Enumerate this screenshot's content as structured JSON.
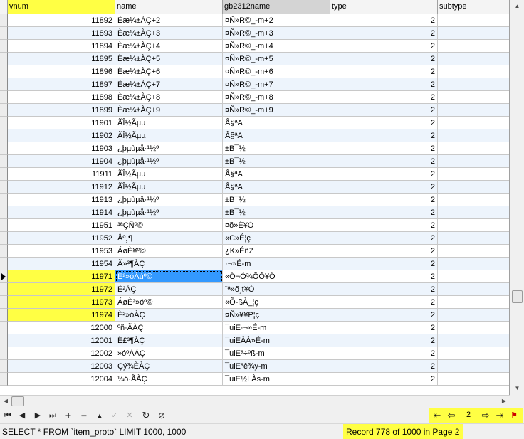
{
  "columns": [
    "vnum",
    "name",
    "gb2312name",
    "type",
    "subtype"
  ],
  "rows": [
    {
      "vnum": "11892",
      "name": "Èæ¼±ÀÇ+2",
      "gb": "¤Ñ»R©_-m+2",
      "type": "2",
      "subtype": ""
    },
    {
      "vnum": "11893",
      "name": "Èæ¼±ÀÇ+3",
      "gb": "¤Ñ»R©_-m+3",
      "type": "2",
      "subtype": ""
    },
    {
      "vnum": "11894",
      "name": "Èæ¼±ÀÇ+4",
      "gb": "¤Ñ»R©_-m+4",
      "type": "2",
      "subtype": ""
    },
    {
      "vnum": "11895",
      "name": "Èæ¼±ÀÇ+5",
      "gb": "¤Ñ»R©_-m+5",
      "type": "2",
      "subtype": ""
    },
    {
      "vnum": "11896",
      "name": "Èæ¼±ÀÇ+6",
      "gb": "¤Ñ»R©_-m+6",
      "type": "2",
      "subtype": ""
    },
    {
      "vnum": "11897",
      "name": "Èæ¼±ÀÇ+7",
      "gb": "¤Ñ»R©_-m+7",
      "type": "2",
      "subtype": ""
    },
    {
      "vnum": "11898",
      "name": "Èæ¼±ÀÇ+8",
      "gb": "¤Ñ»R©_-m+8",
      "type": "2",
      "subtype": ""
    },
    {
      "vnum": "11899",
      "name": "Èæ¼±ÀÇ+9",
      "gb": "¤Ñ»R©_-m+9",
      "type": "2",
      "subtype": ""
    },
    {
      "vnum": "11901",
      "name": "ÃÎ½Ãµµ",
      "gb": "Â§ªA",
      "type": "2",
      "subtype": ""
    },
    {
      "vnum": "11902",
      "name": "ÃÎ½Ãµµ",
      "gb": "Â§ªA",
      "type": "2",
      "subtype": ""
    },
    {
      "vnum": "11903",
      "name": "¿þµùµå·¹½º",
      "gb": "±B¯½",
      "type": "2",
      "subtype": ""
    },
    {
      "vnum": "11904",
      "name": "¿þµùµå·¹½º",
      "gb": "±B¯½",
      "type": "2",
      "subtype": ""
    },
    {
      "vnum": "11911",
      "name": "ÃÎ½Ãµµ",
      "gb": "Â§ªA",
      "type": "2",
      "subtype": ""
    },
    {
      "vnum": "11912",
      "name": "ÃÎ½Ãµµ",
      "gb": "Â§ªA",
      "type": "2",
      "subtype": ""
    },
    {
      "vnum": "11913",
      "name": "¿þµùµå·¹½º",
      "gb": "±B¯½",
      "type": "2",
      "subtype": ""
    },
    {
      "vnum": "11914",
      "name": "¿þµùµå·¹½º",
      "gb": "±B¯½",
      "type": "2",
      "subtype": ""
    },
    {
      "vnum": "11951",
      "name": "³ªÇÑº©",
      "gb": "¤õ»É¥Ò",
      "type": "2",
      "subtype": ""
    },
    {
      "vnum": "11952",
      "name": "Åº¸¶",
      "gb": "«C»É¦ç",
      "type": "2",
      "subtype": ""
    },
    {
      "vnum": "11953",
      "name": "ÁøÈ¥º©",
      "gb": "¿K»ÉñZ",
      "type": "2",
      "subtype": ""
    },
    {
      "vnum": "11954",
      "name": "Ã»³¶ÀÇ",
      "gb": "·¬»É-m",
      "type": "2",
      "subtype": ""
    },
    {
      "vnum": "11971",
      "name": "È²»óÀúº©",
      "gb": "«Ò¬Ó¾ÕÔ¥Ò",
      "type": "2",
      "subtype": ""
    },
    {
      "vnum": "11972",
      "name": "È²ÀÇ",
      "gb": "¨ª»õ¸t¥Ò",
      "type": "2",
      "subtype": ""
    },
    {
      "vnum": "11973",
      "name": "ÁøÈ²»óº©",
      "gb": "«Õ-ßÀ_¦ç",
      "type": "2",
      "subtype": ""
    },
    {
      "vnum": "11974",
      "name": "È²»óÀÇ",
      "gb": "¤Ñ»¥¥P¦ç",
      "type": "2",
      "subtype": ""
    },
    {
      "vnum": "12000",
      "name": "ºñ·ÃÀÇ",
      "gb": "¯uiE·¬»É-m",
      "type": "2",
      "subtype": ""
    },
    {
      "vnum": "12001",
      "name": "È£³¶ÀÇ",
      "gb": "¯uiEÂÂ»É-m",
      "type": "2",
      "subtype": ""
    },
    {
      "vnum": "12002",
      "name": "»óºÀÀÇ",
      "gb": "¯uiEª÷ºß-m",
      "type": "2",
      "subtype": ""
    },
    {
      "vnum": "12003",
      "name": "Çý¾ÈÀÇ",
      "gb": "¯uiEªê¾y-m",
      "type": "2",
      "subtype": ""
    },
    {
      "vnum": "12004",
      "name": "¼ö·ÃÀÇ",
      "gb": "¯uiE½LÀs-m",
      "type": "2",
      "subtype": ""
    }
  ],
  "selected_row_index": 20,
  "highlighted_vnum_rows": [
    20,
    21,
    22,
    23
  ],
  "navigator": {
    "first_icon": "first-record-icon",
    "prev_icon": "prev-record-icon",
    "next_icon": "next-record-icon",
    "last_icon": "last-record-icon",
    "insert_icon": "insert-icon",
    "delete_icon": "delete-icon",
    "edit_icon": "edit-icon",
    "post_icon": "post-icon",
    "cancel_icon": "cancel-icon",
    "refresh_icon": "refresh-icon",
    "clear_icon": "clear-icon"
  },
  "pager": {
    "page_value": "2"
  },
  "status": {
    "sql": "SELECT * FROM `item_proto` LIMIT 1000, 1000",
    "record": "Record 778 of 1000 in Page 2"
  },
  "colors": {
    "highlight": "#ffff44",
    "selection": "#3399ff",
    "alt_row": "#edf4fc"
  }
}
